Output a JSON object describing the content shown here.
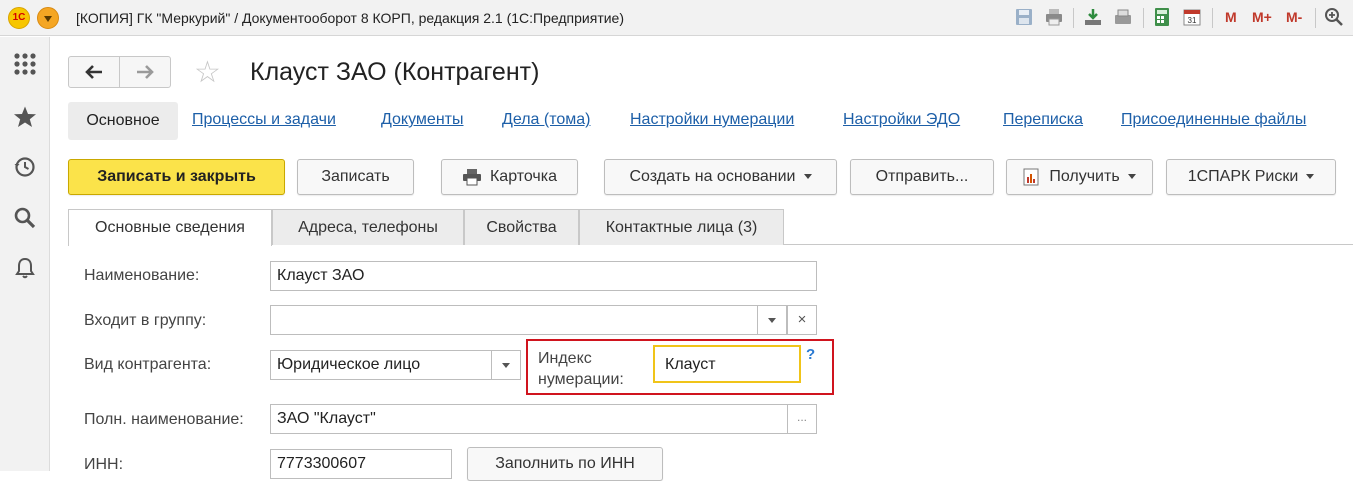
{
  "window": {
    "title": "[КОПИЯ] ГК \"Меркурий\" / Документооборот 8 КОРП, редакция 2.1   (1С:Предприятие)",
    "logo_text": "1С",
    "mem_buttons": [
      "M",
      "M+",
      "M-"
    ]
  },
  "form": {
    "title": "Клауст ЗАО (Контрагент)"
  },
  "nav": {
    "main": "Основное",
    "links": [
      "Процессы и задачи",
      "Документы",
      "Дела (тома)",
      "Настройки нумерации",
      "Настройки ЭДО",
      "Переписка",
      "Присоединенные файлы"
    ]
  },
  "toolbar": {
    "save_close": "Записать и закрыть",
    "save": "Записать",
    "card": "Карточка",
    "create_based": "Создать на основании",
    "send": "Отправить...",
    "receive": "Получить",
    "spark": "1СПАРК Риски"
  },
  "tabs": [
    "Основные сведения",
    "Адреса, телефоны",
    "Свойства",
    "Контактные лица (3)"
  ],
  "fields": {
    "name_label": "Наименование:",
    "name_value": "Клауст ЗАО",
    "group_label": "Входит в группу:",
    "group_value": "",
    "type_label": "Вид контрагента:",
    "type_value": "Юридическое лицо",
    "index_label_line1": "Индекс",
    "index_label_line2": "нумерации:",
    "index_value": "Клауст",
    "full_name_label": "Полн. наименование:",
    "full_name_value": "ЗАО \"Клауст\"",
    "inn_label": "ИНН:",
    "inn_value": "7773300607",
    "fill_inn_button": "Заполнить по ИНН",
    "help_mark": "?",
    "clear_mark": "×",
    "ellipsis_mark": "..."
  },
  "colors": {
    "link": "#1d5fa8",
    "primary_button": "#fbe34a",
    "highlight": "#d0141e",
    "focus_border": "#f0c419"
  }
}
